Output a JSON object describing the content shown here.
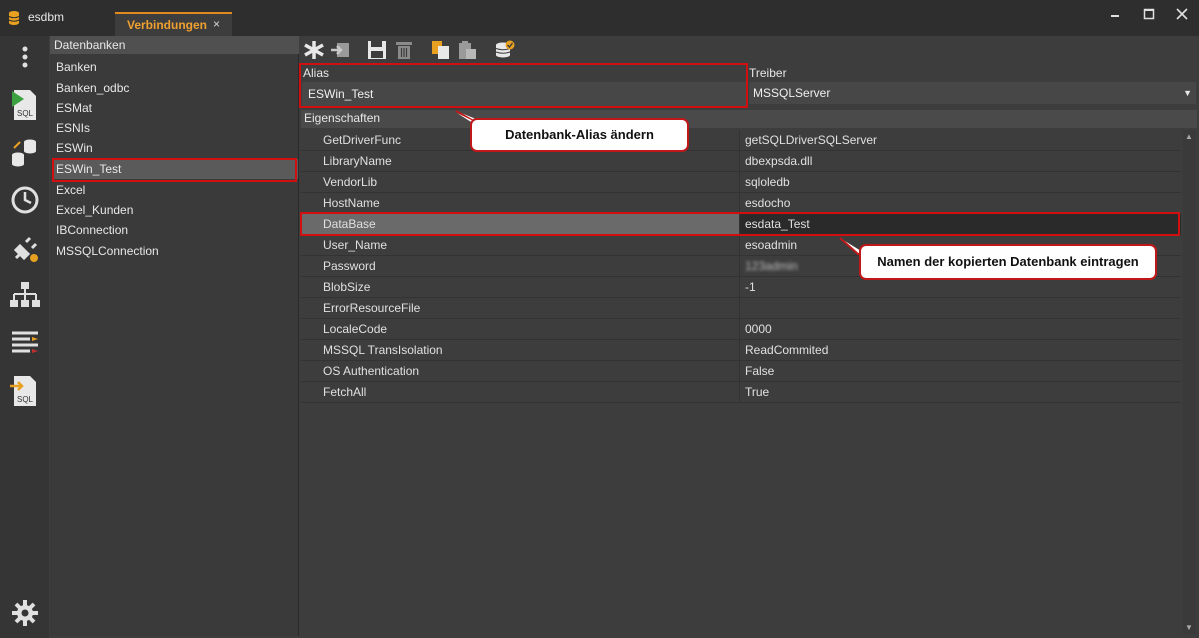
{
  "window": {
    "app_title": "esdbm",
    "tab_label": "Verbindungen",
    "tab_close": "×",
    "accent": "#e08a1e"
  },
  "sidebar_icons": [
    "more-icon",
    "sql-run-icon",
    "db-transfer-icon",
    "history-icon",
    "plugin-icon",
    "hierarchy-icon",
    "compare-icon",
    "sql-export-icon",
    "settings-icon"
  ],
  "connections": {
    "header": "Datenbanken",
    "items": [
      "Banken",
      "Banken_odbc",
      "ESMat",
      "ESNIs",
      "ESWin",
      "ESWin_Test",
      "Excel",
      "Excel_Kunden",
      "IBConnection",
      "MSSQLConnection"
    ],
    "selected": "ESWin_Test"
  },
  "toolbar": [
    "new-icon",
    "import-icon",
    "save-icon",
    "delete-icon",
    "copy-icon",
    "paste-icon",
    "db-check-icon"
  ],
  "form": {
    "alias_label": "Alias",
    "alias_value": "ESWin_Test",
    "treiber_label": "Treiber",
    "treiber_value": "MSSQLServer",
    "properties_label": "Eigenschaften"
  },
  "properties": [
    {
      "name": "GetDriverFunc",
      "value": "getSQLDriverSQLServer"
    },
    {
      "name": "LibraryName",
      "value": "dbexpsda.dll"
    },
    {
      "name": "VendorLib",
      "value": "sqloledb"
    },
    {
      "name": "HostName",
      "value": "esdocho"
    },
    {
      "name": "DataBase",
      "value": "esdata_Test"
    },
    {
      "name": "User_Name",
      "value": "esoadmin"
    },
    {
      "name": "Password",
      "value": "123admin"
    },
    {
      "name": "BlobSize",
      "value": "-1"
    },
    {
      "name": "ErrorResourceFile",
      "value": ""
    },
    {
      "name": "LocaleCode",
      "value": "0000"
    },
    {
      "name": "MSSQL TransIsolation",
      "value": "ReadCommited"
    },
    {
      "name": "OS Authentication",
      "value": "False"
    },
    {
      "name": "FetchAll",
      "value": "True"
    }
  ],
  "annotations": {
    "alias_callout": "Datenbank-Alias ändern",
    "database_callout": "Namen der kopierten Datenbank eintragen",
    "highlight_color": "#d01010"
  }
}
